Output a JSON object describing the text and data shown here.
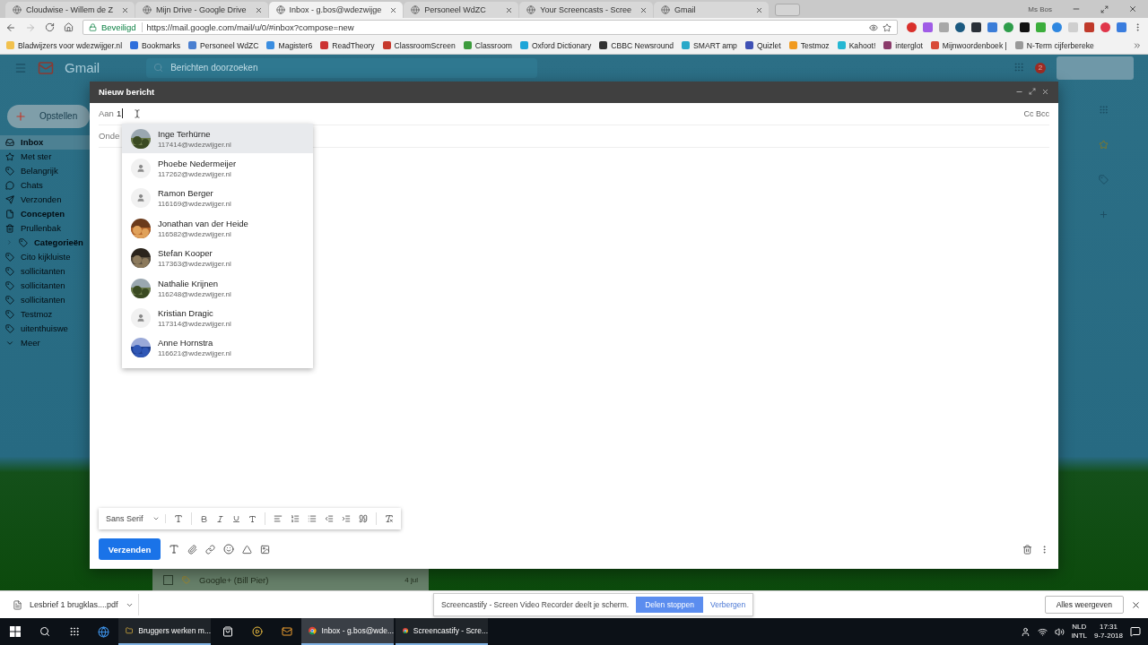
{
  "browser": {
    "tabs": [
      {
        "title": "Cloudwise - Willem de Z",
        "selected": false
      },
      {
        "title": "Mijn Drive - Google Drive",
        "selected": false
      },
      {
        "title": "Inbox - g.bos@wdezwijge",
        "selected": true
      },
      {
        "title": "Personeel WdZC",
        "selected": false
      },
      {
        "title": "Your Screencasts - Scree",
        "selected": false
      },
      {
        "title": "Gmail",
        "selected": false
      }
    ],
    "profile": "Ms Bos",
    "address": {
      "security": "Beveiligd",
      "url": "https://mail.google.com/mail/u/0/#inbox?compose=new"
    },
    "bookmarks": [
      "Bladwijzers voor wdezwijger.nl",
      "Bookmarks",
      "Personeel WdZC",
      "Magister6",
      "ReadTheory",
      "ClassroomScreen",
      "Classroom",
      "Oxford Dictionary",
      "CBBC Newsround",
      "SMART amp",
      "Quizlet",
      "Testmoz",
      "Kahoot!",
      "interglot",
      "Mijnwoordenboek |",
      "N-Term cijferbereke"
    ]
  },
  "gmail": {
    "logo": "Gmail",
    "search": {
      "placeholder": "Berichten doorzoeken"
    },
    "notifications": "2",
    "compose_button": "Opstellen",
    "sidebar": [
      {
        "label": "Inbox",
        "kind": "inbox",
        "bold": true,
        "selected": true
      },
      {
        "label": "Met ster",
        "kind": "starred",
        "bold": false,
        "selected": false
      },
      {
        "label": "Belangrijk",
        "kind": "important",
        "bold": false,
        "selected": false
      },
      {
        "label": "Chats",
        "kind": "chats",
        "bold": false,
        "selected": false
      },
      {
        "label": "Verzonden",
        "kind": "sent",
        "bold": false,
        "selected": false
      },
      {
        "label": "Concepten",
        "kind": "drafts",
        "bold": true,
        "selected": false
      },
      {
        "label": "Prullenbak",
        "kind": "trash",
        "bold": false,
        "selected": false
      },
      {
        "label": "Categorieën",
        "kind": "category",
        "bold": true,
        "selected": false,
        "expanded": false
      },
      {
        "label": "Cito kijkluiste",
        "kind": "label",
        "bold": false,
        "selected": false
      },
      {
        "label": "sollicitanten",
        "kind": "label",
        "bold": false,
        "selected": false
      },
      {
        "label": "sollicitanten",
        "kind": "label",
        "bold": false,
        "selected": false
      },
      {
        "label": "sollicitanten",
        "kind": "label",
        "bold": false,
        "selected": false
      },
      {
        "label": "Testmoz",
        "kind": "label",
        "bold": false,
        "selected": false
      },
      {
        "label": "uitenthuiswe",
        "kind": "label",
        "bold": false,
        "selected": false
      },
      {
        "label": "Meer",
        "kind": "more",
        "bold": false,
        "selected": false
      }
    ],
    "background_email": {
      "sender": "Google+ (Bill Pier)",
      "date": "4 jul",
      "checked": false
    }
  },
  "compose": {
    "title": "Nieuw bericht",
    "to": {
      "label": "Aan",
      "value": "1"
    },
    "cc_bcc": "Cc Bcc",
    "subject": {
      "placeholder": "Onde"
    },
    "suggestions": [
      {
        "name": "Inge Terhürne",
        "email": "117414@wdezwijger.nl",
        "selected": true
      },
      {
        "name": "Phoebe Nedermeijer",
        "email": "117262@wdezwijger.nl",
        "kind": "generic",
        "selected": false
      },
      {
        "name": "Ramon Berger",
        "email": "116169@wdezwijger.nl",
        "kind": "generic",
        "selected": false
      },
      {
        "name": "Jonathan van der Heide",
        "email": "116582@wdezwijger.nl",
        "selected": false
      },
      {
        "name": "Stefan Kooper",
        "email": "117363@wdezwijger.nl",
        "selected": false
      },
      {
        "name": "Nathalie Krijnen",
        "email": "116248@wdezwijger.nl",
        "selected": false
      },
      {
        "name": "Kristian Dragic",
        "email": "117314@wdezwijger.nl",
        "kind": "generic",
        "selected": false
      },
      {
        "name": "Anne Hornstra",
        "email": "116621@wdezwijger.nl",
        "selected": false
      }
    ],
    "font": "Sans Serif",
    "send": "Verzenden"
  },
  "downloads": {
    "file": "Lesbrief 1 brugklas....pdf",
    "show_all": "Alles weergeven"
  },
  "sharing": {
    "message": "Screencastify - Screen Video Recorder deelt je scherm.",
    "stop": "Delen stoppen",
    "hide": "Verbergen"
  },
  "taskbar": {
    "apps": [
      {
        "label": "Bruggers werken m...",
        "kind": "folder",
        "active": false
      },
      {
        "label": "Inbox - g.bos@wde...",
        "kind": "chrome",
        "active": true
      },
      {
        "label": "Screencastify - Scre...",
        "kind": "chrome",
        "active": false
      }
    ],
    "language": "NLD",
    "layout": "INTL",
    "time": "17:31",
    "date": "9-7-2018"
  }
}
